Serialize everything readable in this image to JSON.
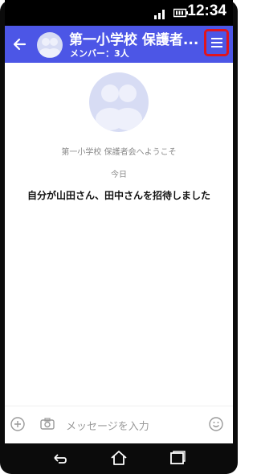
{
  "status_bar": {
    "time": "12:34"
  },
  "header": {
    "title": "第一小学校 保護者...",
    "subtitle": "メンバー：3人"
  },
  "chat": {
    "welcome_text": "第一小学校 保護者会へようこそ",
    "date_label": "今日",
    "system_message": "自分が山田さん、田中さんを招待しました"
  },
  "composer": {
    "placeholder": "メッセージを入力"
  },
  "colors": {
    "header_bg": "#4c56e6",
    "menu_highlight": "#e1141d",
    "avatar_bg": "#d7dcf4"
  },
  "icons": [
    "back-arrow-icon",
    "group-avatar-icon",
    "menu-icon",
    "add-icon",
    "camera-icon",
    "emoji-icon",
    "nav-back-icon",
    "nav-home-icon",
    "nav-recents-icon"
  ]
}
